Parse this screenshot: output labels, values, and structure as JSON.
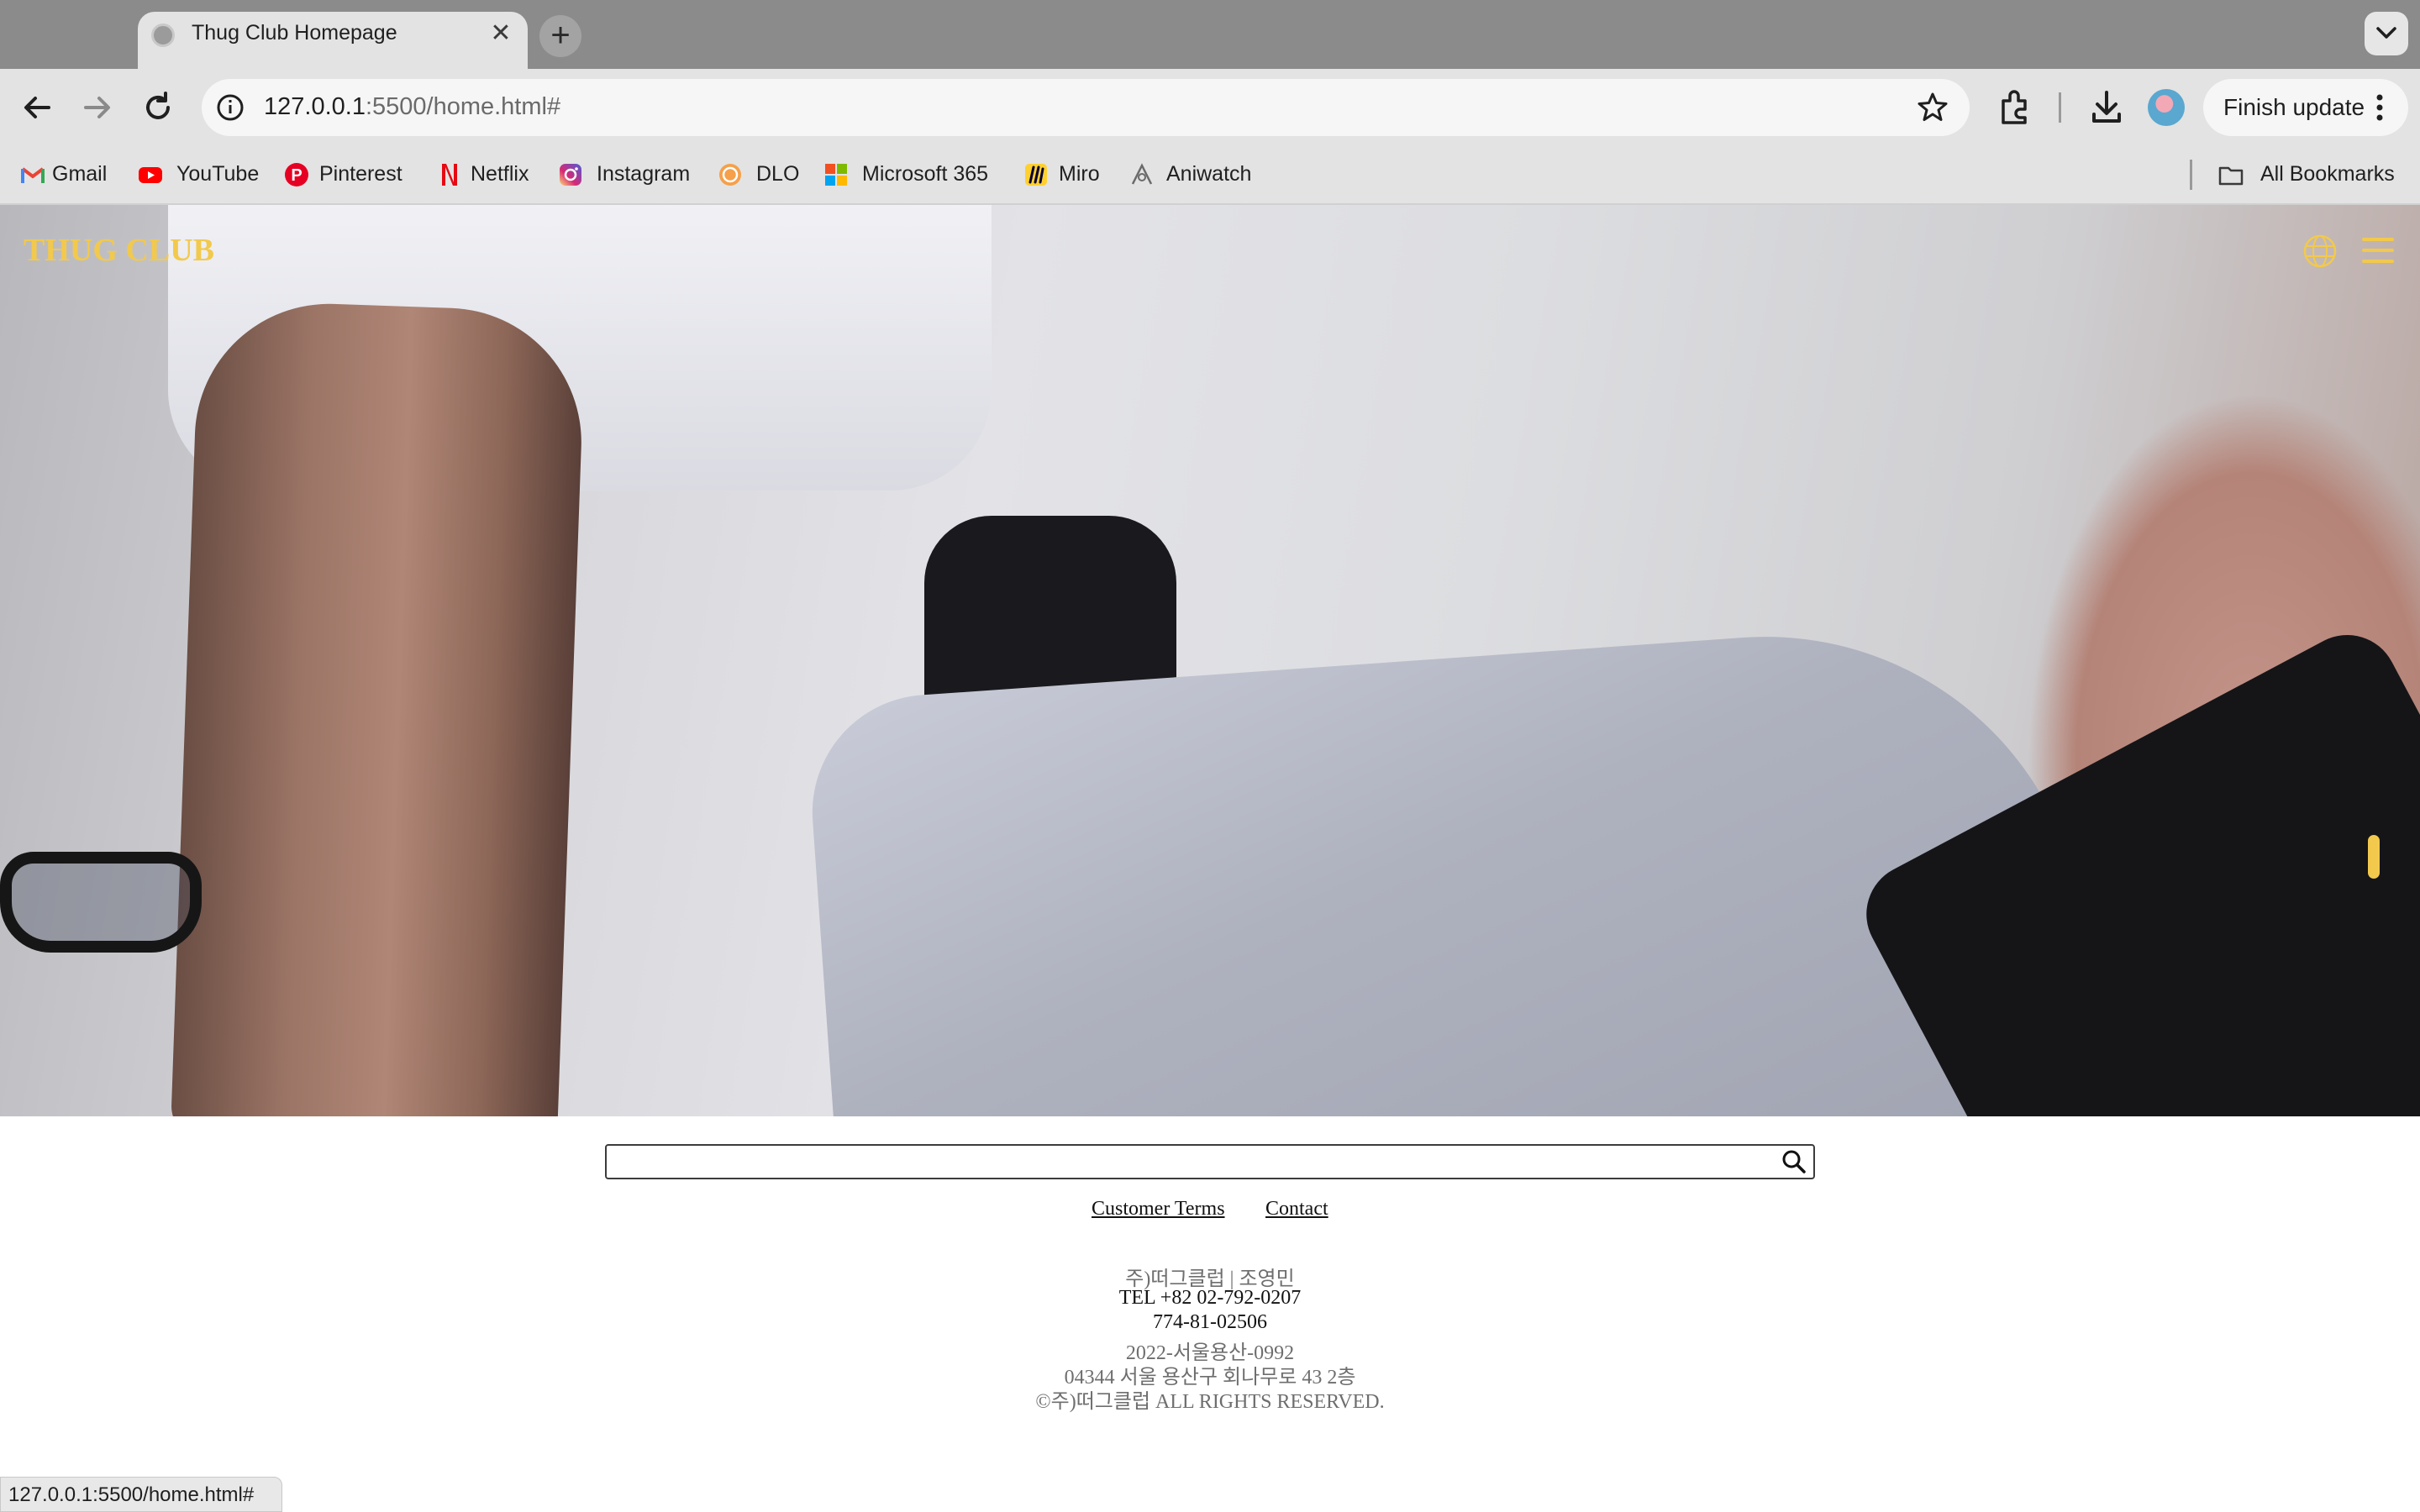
{
  "browser": {
    "tab_title": "Thug Club Homepage",
    "tab_close": "✕",
    "new_tab": "+",
    "url_host": "127.0.0.1",
    "url_path": ":5500/home.html#",
    "finish_update_label": "Finish update",
    "status_url": "127.0.0.1:5500/home.html#"
  },
  "bookmarks": [
    {
      "label": "Gmail",
      "icon": "gmail-icon"
    },
    {
      "label": "YouTube",
      "icon": "youtube-icon"
    },
    {
      "label": "Pinterest",
      "icon": "pinterest-icon"
    },
    {
      "label": "Netflix",
      "icon": "netflix-icon"
    },
    {
      "label": "Instagram",
      "icon": "instagram-icon"
    },
    {
      "label": "DLO",
      "icon": "dlo-icon"
    },
    {
      "label": "Microsoft 365",
      "icon": "microsoft-365-icon"
    },
    {
      "label": "Miro",
      "icon": "miro-icon"
    },
    {
      "label": "Aniwatch",
      "icon": "aniwatch-icon"
    },
    {
      "label": "All Bookmarks",
      "icon": "folder-icon"
    }
  ],
  "page": {
    "brand": "THUG CLUB",
    "accent_color": "#f2c94c",
    "search_placeholder": "",
    "links": {
      "customer_terms": "Customer Terms",
      "contact": "Contact"
    },
    "company_info": [
      "주)떠그클럽 | 조영민",
      "TEL +82 02-792-0207",
      "774-81-02506",
      "2022-서울용산-0992",
      "04344 서울 용산구 회나무로 43 2층",
      "©주)떠그클럽 ALL RIGHTS RESERVED."
    ]
  }
}
